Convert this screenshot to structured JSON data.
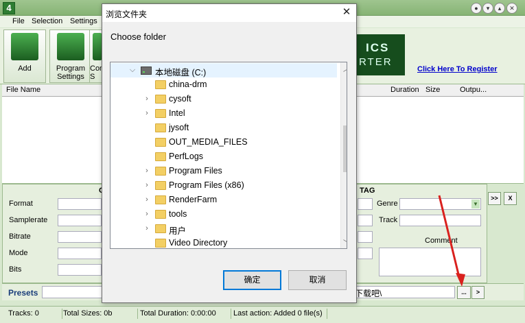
{
  "app": {
    "icon_text": "4",
    "menu": [
      "File",
      "Selection",
      "Settings"
    ],
    "toolbar": [
      {
        "label": "Add"
      },
      {
        "label": "Program Settings"
      },
      {
        "label": "Com S"
      }
    ],
    "logo_text": "ICS",
    "logo_text2": "RTER",
    "register_link": "Click Here To Register",
    "columns": {
      "file_name": "File Name",
      "duration": "Duration",
      "size": "Size",
      "output": "Outpu..."
    },
    "props": {
      "section_left": "C",
      "section_tag": "TAG",
      "format": "Format",
      "samplerate": "Samplerate",
      "bitrate": "Bitrate",
      "mode": "Mode",
      "bits": "Bits",
      "genre": "Genre",
      "track": "Track",
      "comment": "Comment"
    },
    "side_buttons": [
      ">>",
      "X"
    ],
    "presets_label": "Presets",
    "path_partial": "下载吧\\",
    "browse_button": "...",
    "next_button": ">",
    "status": {
      "tracks": "Tracks: 0",
      "total_sizes": "Total Sizes: 0b",
      "total_duration": "Total Duration: 0:00:00",
      "last_action": "Last action: Added 0 file(s)"
    }
  },
  "dialog": {
    "title": "浏览文件夹",
    "close": "✕",
    "prompt": "Choose folder",
    "drive": "本地磁盘 (C:)",
    "folders": [
      {
        "name": "china-drm",
        "expandable": false
      },
      {
        "name": "cysoft",
        "expandable": true
      },
      {
        "name": "Intel",
        "expandable": true
      },
      {
        "name": "jysoft",
        "expandable": false
      },
      {
        "name": "OUT_MEDIA_FILES",
        "expandable": false
      },
      {
        "name": "PerfLogs",
        "expandable": false
      },
      {
        "name": "Program Files",
        "expandable": true
      },
      {
        "name": "Program Files (x86)",
        "expandable": true
      },
      {
        "name": "RenderFarm",
        "expandable": true
      },
      {
        "name": "tools",
        "expandable": true
      },
      {
        "name": "用户",
        "expandable": true
      },
      {
        "name": "Video Directory",
        "expandable": false
      }
    ],
    "ok_button": "确定",
    "cancel_button": "取消"
  },
  "colors": {
    "accent": "#0078d7",
    "arrow": "#d9211e",
    "folder": "#f3cf64"
  }
}
